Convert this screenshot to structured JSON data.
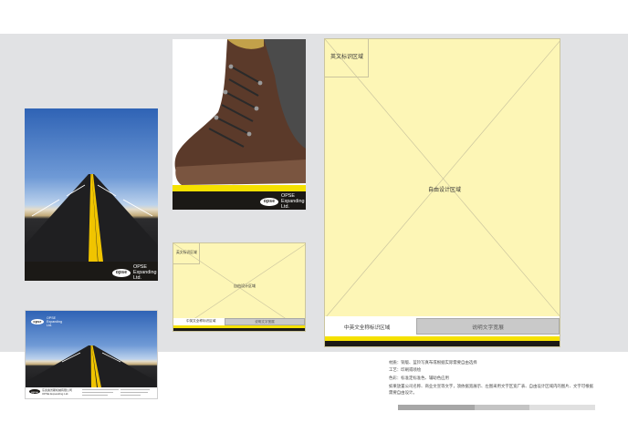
{
  "colors": {
    "band": "#e1e2e4",
    "placeholder_fill": "#fdf6b6",
    "accent_yellow": "#f5e100",
    "black": "#1b1916"
  },
  "brand": {
    "logo_mark": "opse",
    "name_lines": "OPSE\nExpanding\nLtd."
  },
  "brochure_cover": {
    "image_icon": "road-photo-icon"
  },
  "boot_page": {
    "image_icon": "work-boot-photo-icon"
  },
  "small_card": {
    "tag_label": "英文标识区域",
    "center_label": "自由设计区域",
    "footer_left": "中英文全称标识区域",
    "footer_right": "说明文字宽展"
  },
  "large_template": {
    "tag_label": "英文标识区域",
    "center_label": "自由设计区域",
    "footer_left": "中英文全称标识区域",
    "footer_right": "说明文字宽展"
  },
  "envelope": {
    "company_cn": "东莞奥普斯机械有限公司",
    "company_en": "OPSE Expanding Ltd."
  },
  "notes": {
    "line1": "材质：铜版、蓝铃写真布或根据实际需要自由选择",
    "line2": "工艺：印刷或喷绘",
    "line3": "色彩：标准定标准色、辅助色应用",
    "paragraph": "如果放置公司名称、商业文宣等文字，须依据宽展示、左图采用文字区宽广表、自由设计区域内的图片、文字可根据需要自由设计。"
  }
}
